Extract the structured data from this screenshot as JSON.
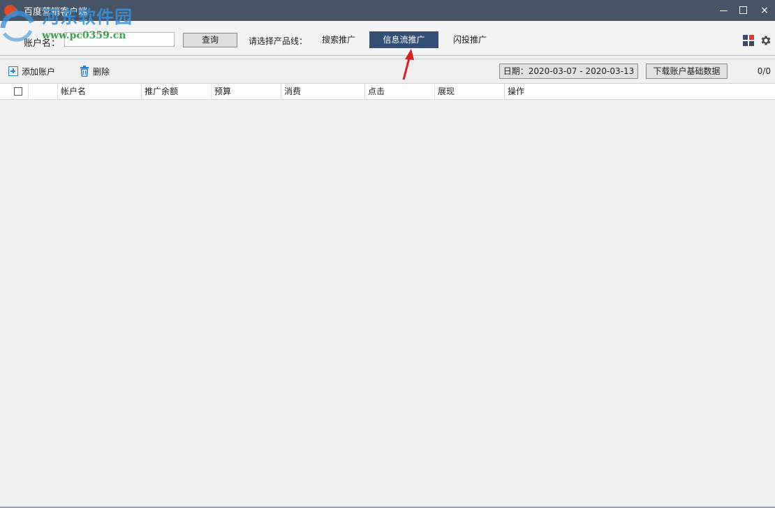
{
  "window": {
    "title": "百度营销客户端",
    "controls": {
      "minimize": "minimize",
      "maximize": "maximize",
      "close": "×"
    }
  },
  "watermark": {
    "line1": "河东软件园",
    "line2": "www.pc0359.cn"
  },
  "search": {
    "account_label": "账户名：",
    "account_value": "",
    "query_button": "查询",
    "product_label": "请选择产品线：",
    "product_tabs": [
      {
        "label": "搜索推广",
        "active": false
      },
      {
        "label": "信息流推广",
        "active": true
      },
      {
        "label": "闪投推广",
        "active": false
      }
    ]
  },
  "toolbar": {
    "add_label": "添加账户",
    "delete_label": "删除",
    "date_button": "日期：2020-03-07 - 2020-03-13",
    "download_button": "下载账户基础数据",
    "page_count": "0/0"
  },
  "table": {
    "columns": [
      "帐户名",
      "推广余额",
      "预算",
      "消费",
      "点击",
      "展现",
      "操作"
    ],
    "rows": []
  },
  "colors": {
    "titlebar": "#475466",
    "active_tab": "#334f74",
    "accent_icon": "#2b7ed6",
    "arrow": "#d42020"
  }
}
